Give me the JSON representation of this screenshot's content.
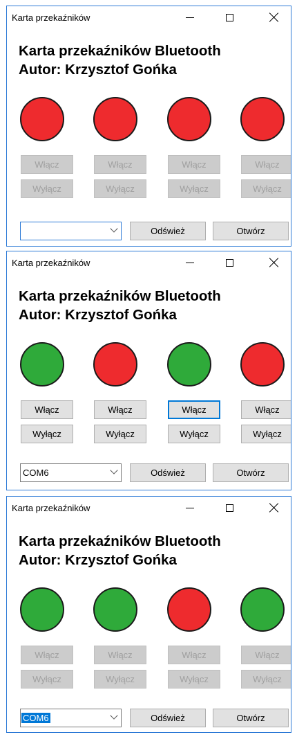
{
  "windows": [
    {
      "title": "Karta przekaźników",
      "heading_line1": "Karta przekaźników Bluetooth",
      "heading_line2": "Autor: Krzysztof Gońka",
      "leds": [
        "red",
        "red",
        "red",
        "red"
      ],
      "on_label": "Włącz",
      "off_label": "Wyłącz",
      "buttons_enabled": false,
      "port_value": "",
      "refresh_label": "Odśwież",
      "open_label": "Otwórz"
    },
    {
      "title": "Karta przekaźników",
      "heading_line1": "Karta przekaźników Bluetooth",
      "heading_line2": "Autor: Krzysztof Gońka",
      "leds": [
        "green",
        "red",
        "green",
        "red"
      ],
      "on_label": "Włącz",
      "off_label": "Wyłącz",
      "buttons_enabled": true,
      "port_value": "COM6",
      "refresh_label": "Odśwież",
      "open_label": "Otwórz"
    },
    {
      "title": "Karta przekaźników",
      "heading_line1": "Karta przekaźników Bluetooth",
      "heading_line2": "Autor: Krzysztof Gońka",
      "leds": [
        "green",
        "green",
        "red",
        "green"
      ],
      "on_label": "Włącz",
      "off_label": "Wyłącz",
      "buttons_enabled": false,
      "port_value": "COM6",
      "refresh_label": "Odśwież",
      "open_label": "Otwórz"
    }
  ],
  "colors": {
    "red": "#ee2b2e",
    "green": "#2faa3a",
    "focus": "#0078d7"
  }
}
